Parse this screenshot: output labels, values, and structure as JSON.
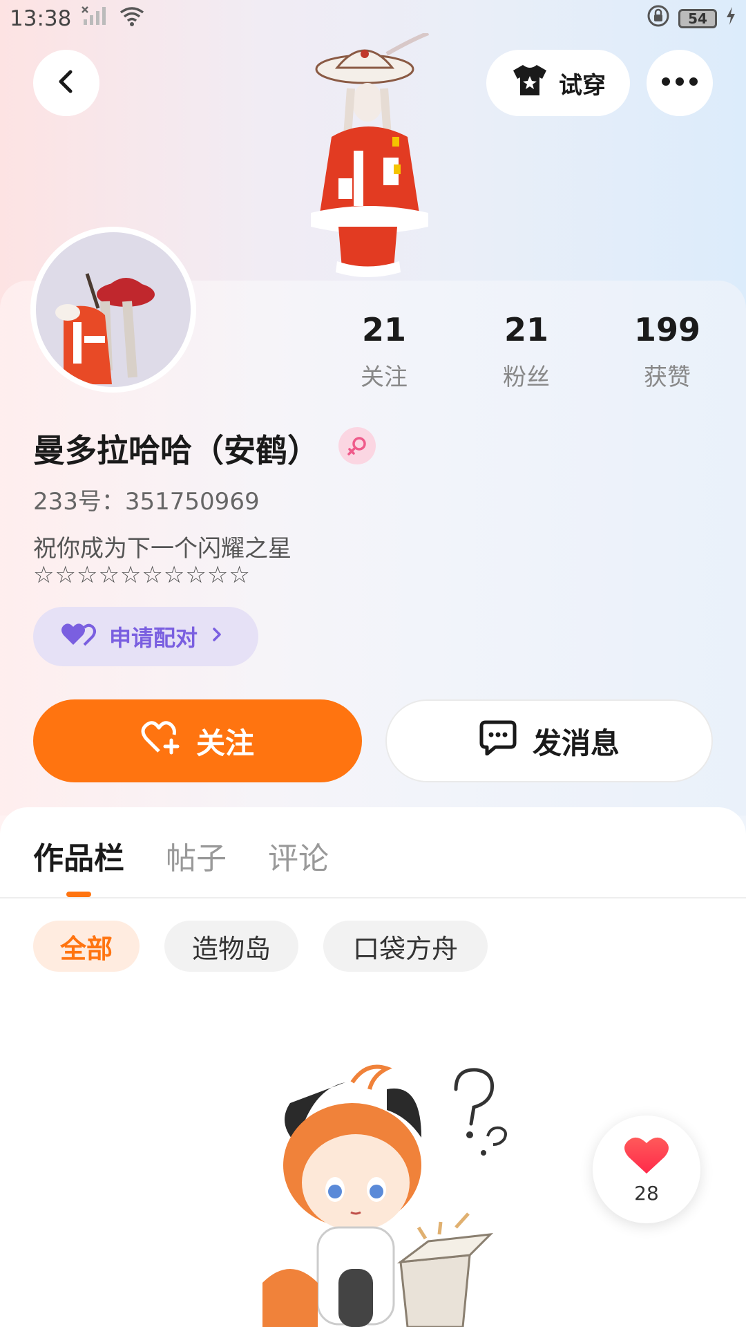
{
  "status_bar": {
    "time": "13:38",
    "battery": "54"
  },
  "header": {
    "try_on_label": "试穿"
  },
  "profile": {
    "nickname": "曼多拉哈哈（安鹤）",
    "user_id": "233号：351750969",
    "bio_line1": "祝你成为下一个闪耀之星",
    "bio_line2": "☆☆☆☆☆☆☆☆☆☆",
    "gender": "female-icon"
  },
  "stats": [
    {
      "value": "21",
      "label": "关注"
    },
    {
      "value": "21",
      "label": "粉丝"
    },
    {
      "value": "199",
      "label": "获赞"
    }
  ],
  "pair_button": {
    "label": "申请配对"
  },
  "actions": {
    "follow_label": "关注",
    "message_label": "发消息"
  },
  "tabs": [
    {
      "label": "作品栏",
      "active": true
    },
    {
      "label": "帖子",
      "active": false
    },
    {
      "label": "评论",
      "active": false
    }
  ],
  "filters": [
    {
      "label": "全部",
      "active": true
    },
    {
      "label": "造物岛",
      "active": false
    },
    {
      "label": "口袋方舟",
      "active": false
    }
  ],
  "like_widget": {
    "count": "28"
  },
  "colors": {
    "accent": "#ff7410",
    "pair_purple": "#7a5fe0",
    "like_red": "#ff3b4e"
  }
}
